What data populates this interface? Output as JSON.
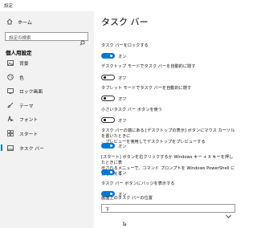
{
  "window": {
    "title": "設定"
  },
  "sidebar": {
    "home_label": "ホーム",
    "search_placeholder": "設定の検索",
    "section_title": "個人用設定",
    "items": [
      {
        "label": "背景",
        "icon": "image-icon"
      },
      {
        "label": "色",
        "icon": "palette-icon"
      },
      {
        "label": "ロック画面",
        "icon": "lock-screen-icon"
      },
      {
        "label": "テーマ",
        "icon": "brush-icon"
      },
      {
        "label": "フォント",
        "icon": "font-icon"
      },
      {
        "label": "スタート",
        "icon": "start-icon"
      },
      {
        "label": "タスク バー",
        "icon": "taskbar-icon",
        "active": true
      }
    ]
  },
  "main": {
    "title": "タスク バー",
    "settings": [
      {
        "label": "タスク バーをロックする",
        "state": "オン",
        "on": true
      },
      {
        "label": "デスクトップ モードでタスク バーを自動的に隠す",
        "state": "オフ",
        "on": false
      },
      {
        "label": "タブレット モードでタスク バーを自動的に隠す",
        "state": "オフ",
        "on": false
      },
      {
        "label": "小さいタスク バー ボタンを使う",
        "state": "オフ",
        "on": false
      },
      {
        "label_line1": "タスク バーの端にある [デスクトップの表示] ボタンにマウス カーソルを置いたときに",
        "label_line2": "、プレビューを使用してデスクトップをプレビューする",
        "state": "オン",
        "on": true
      },
      {
        "label_line1": "[スタート] ボタンを右クリックするか Windows キー + X キーを押したときに表",
        "label_line2": "示されるメニューで、コマンド プロンプトを Windows PowerShell に置き換える",
        "state": "オン",
        "on": true
      },
      {
        "label": "タスク バー ボタンにバッジを表示する",
        "state": "オン",
        "on": true
      }
    ],
    "position_label": "画面上のタスク バーの位置",
    "position_value": "下"
  },
  "colors": {
    "accent": "#0078d7",
    "sidebar_bg": "#f2f2f2"
  }
}
